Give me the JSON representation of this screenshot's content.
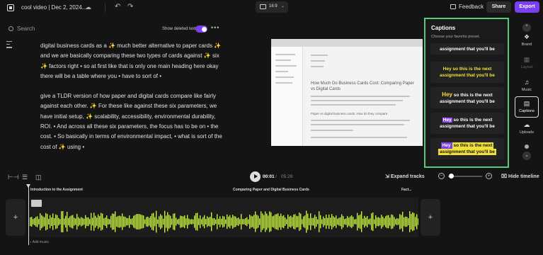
{
  "header": {
    "title": "cool video | Dec 2, 2024...",
    "aspect_ratio": "16:9",
    "feedback_label": "Feedback",
    "share_label": "Share",
    "export_label": "Export",
    "export_color": "#7b3ff2"
  },
  "transcript_panel": {
    "search_placeholder": "Search",
    "show_deleted_label": "Show deleted text",
    "show_deleted_on": true,
    "paragraphs": [
      "digital business cards as a ✨ much better alternative to paper cards ✨ and we are basically comparing these two types of cards against ✨ six ✨ factors right • so at first like that is only one main heading here okay there will be a table where you • have to sort of •",
      "give a TLDR version of how paper and digital cards compare like fairly against each other. ✨ For these like against these six parameters, we have initial setup, ✨ scalability, accessibility, environmental durability, ROI. • And across all these six parameters, the focus has to be on • the cost. • So basically in terms of environmental impact, • what is sort of the cost of ✨ using •"
    ]
  },
  "preview": {
    "heading": "How Much Do Business Cards Cost: Comparing Paper vs Digital Cards",
    "subheading": "Paper vs digital business cards: How do they compare"
  },
  "captions_panel": {
    "title": "Captions",
    "subtitle": "Choose your favorite preset.",
    "accent_border": "#59c97a",
    "presets": [
      {
        "line1": "assignment that you'll be"
      },
      {
        "w1": "Hey",
        "w2": "so this is the next",
        "line2": "assignment that you'll be"
      },
      {
        "w1": "Hey",
        "w2": "so this is the next",
        "line2": "assignment that you'll be"
      },
      {
        "w1": "Hey",
        "w2": "so this is the next",
        "line2": "assignment that you'll be"
      },
      {
        "w1": "Hey",
        "w2": "so this is the next",
        "line2": "assignment that you'll be"
      }
    ]
  },
  "sidebar": {
    "items": [
      {
        "label": "Brand",
        "icon": "brand-icon"
      },
      {
        "label": "Layout",
        "icon": "layout-icon"
      },
      {
        "label": "Music",
        "icon": "music-icon"
      },
      {
        "label": "Captions",
        "icon": "captions-icon"
      },
      {
        "label": "Uploads",
        "icon": "uploads-icon"
      }
    ]
  },
  "playback": {
    "current_time": "00:01",
    "separator": "/",
    "duration": "05:29",
    "expand_label": "Expand tracks",
    "hide_timeline_label": "Hide timeline"
  },
  "timeline": {
    "chapters": [
      "Introduction to the Assignment",
      "Comparing Paper and Digital Business Cards",
      "Fact..."
    ],
    "add_music_label": "Add music",
    "waveform_color": "#c6f03a"
  }
}
